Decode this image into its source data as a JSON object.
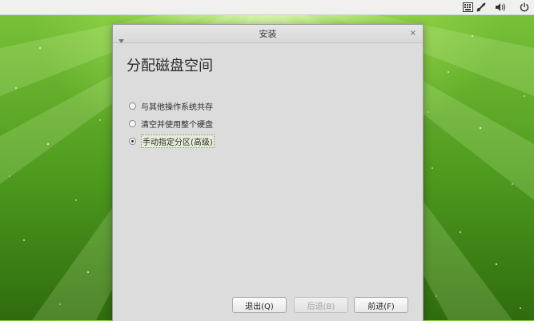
{
  "window": {
    "title": "安装",
    "close_glyph": "×"
  },
  "page": {
    "heading": "分配磁盘空间"
  },
  "options": [
    {
      "label": "与其他操作系统共存",
      "selected": false
    },
    {
      "label": "清空并使用整个硬盘",
      "selected": false
    },
    {
      "label": "手动指定分区(高级)",
      "selected": true
    }
  ],
  "buttons": {
    "quit": "退出(Q)",
    "back": "后退(B)",
    "forward": "前进(F)"
  },
  "tray_icons": [
    "keyboard-icon",
    "network-icon",
    "volume-icon",
    "power-icon"
  ],
  "colors": {
    "wallpaper_green": "#4e9a1e",
    "window_bg": "#dcdcdc"
  }
}
